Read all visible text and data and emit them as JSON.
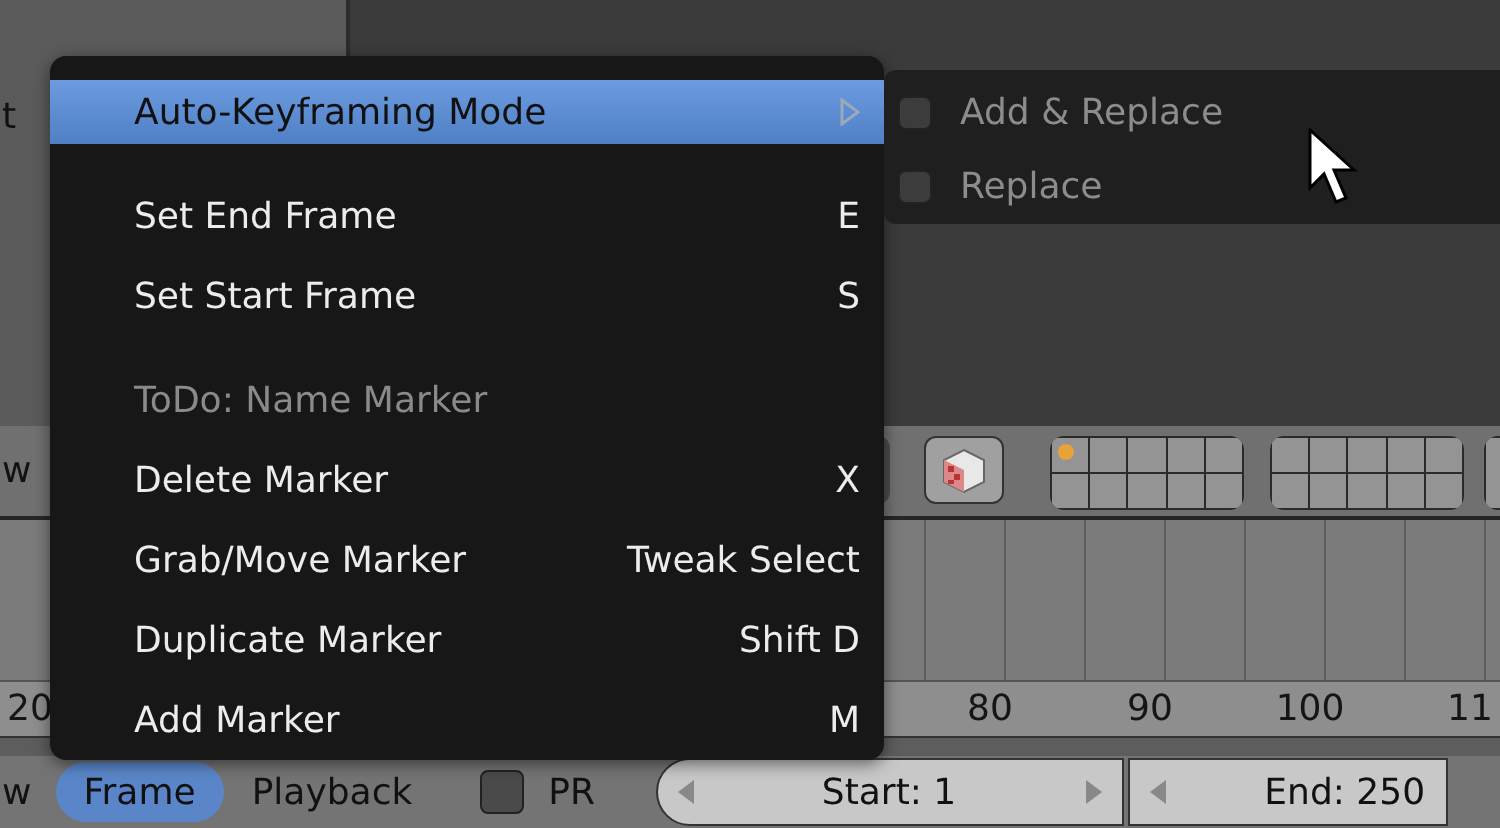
{
  "viewport": {
    "side_label": "t"
  },
  "header": {
    "labels": [
      "w"
    ]
  },
  "ruler": {
    "ticks": [
      "20",
      "80",
      "90",
      "100",
      "11"
    ]
  },
  "bottom_bar": {
    "label": "w",
    "menus": [
      {
        "label": "Frame",
        "selected": true
      },
      {
        "label": "Playback",
        "selected": false
      }
    ],
    "pr_toggle": {
      "label": "PR",
      "checked": false
    },
    "start_field": "Start: 1",
    "end_field": "End: 250"
  },
  "menu": {
    "sections": [
      [
        {
          "kind": "submenu",
          "label": "Auto-Keyframing Mode",
          "selected": true
        }
      ],
      [
        {
          "kind": "item",
          "label": "Set End Frame",
          "shortcut": "E",
          "selected": false
        },
        {
          "kind": "item",
          "label": "Set Start Frame",
          "shortcut": "S",
          "selected": false
        }
      ],
      [
        {
          "kind": "label",
          "label": "ToDo: Name Marker",
          "selected": false
        },
        {
          "kind": "item",
          "label": "Delete Marker",
          "shortcut": "X",
          "selected": false
        },
        {
          "kind": "item",
          "label": "Grab/Move Marker",
          "shortcut": "Tweak Select",
          "selected": false
        },
        {
          "kind": "item",
          "label": "Duplicate Marker",
          "shortcut": "Shift D",
          "selected": false
        },
        {
          "kind": "item",
          "label": "Add Marker",
          "shortcut": "M",
          "selected": false
        }
      ]
    ]
  },
  "submenu": {
    "items": [
      {
        "label": "Add & Replace",
        "checked": false
      },
      {
        "label": "Replace",
        "checked": false
      }
    ]
  }
}
